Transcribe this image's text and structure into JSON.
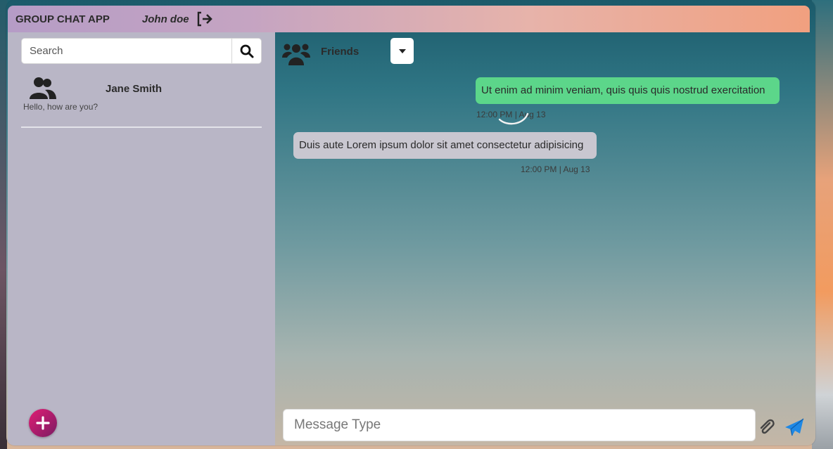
{
  "header": {
    "app_title": "GROUP CHAT APP",
    "user_name": "John doe",
    "logout_icon": "logout-icon"
  },
  "sidebar": {
    "search": {
      "placeholder": "Search",
      "value": "",
      "icon": "search-icon"
    },
    "contacts": [
      {
        "name": "Jane Smith",
        "preview": "Hello, how are you?",
        "icon": "users-icon"
      }
    ],
    "add_button_icon": "plus-icon"
  },
  "chat": {
    "title": "Friends",
    "title_icon": "group-icon",
    "dropdown_icon": "caret-down-icon",
    "messages": [
      {
        "direction": "outgoing",
        "text": "Ut enim ad minim veniam, quis quis quis nostrud exercitation",
        "time": "12:00 PM | Aug 13"
      },
      {
        "direction": "incoming",
        "text": "Duis aute Lorem ipsum dolor sit amet consectetur adipisicing",
        "time": "12:00 PM | Aug 13"
      }
    ],
    "composer": {
      "placeholder": "Message Type",
      "value": ""
    },
    "attach_icon": "paperclip-icon",
    "send_icon": "send-icon"
  },
  "colors": {
    "outgoing_bubble": "#5cd68a",
    "incoming_bubble": "#c9c7d0",
    "sidebar_bg": "#b9b6c6",
    "send_accent": "#1e88e5",
    "fab": "#c2185b"
  }
}
